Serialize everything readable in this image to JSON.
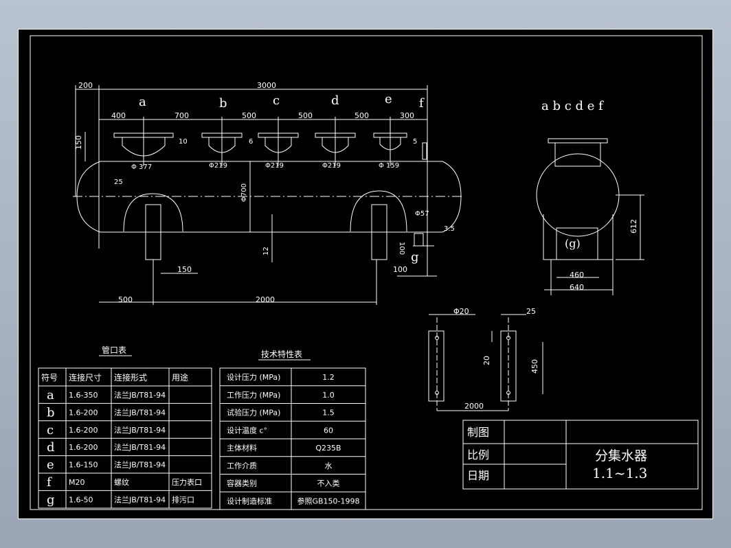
{
  "dims": {
    "d200": "200",
    "d3000": "3000",
    "d400": "400",
    "d700": "700",
    "d500a": "500",
    "d500b": "500",
    "d500c": "500",
    "d300": "300",
    "d150": "150",
    "d10": "10",
    "d6": "6",
    "d5": "5",
    "d25": "25",
    "phi377": "Φ 377",
    "phi219a": "Φ219",
    "phi219b": "Φ219",
    "phi219c": "Φ219",
    "phi159": "Φ 159",
    "phi700": "Φ700",
    "phi57": "Φ57",
    "d3_5": "3.5",
    "d100v": "100",
    "d12": "12",
    "d150b": "150",
    "d100": "100",
    "d500": "500",
    "d2000": "2000",
    "d612": "612",
    "d460": "460",
    "d640": "640",
    "phi20": "Φ20",
    "d25b": "25",
    "d20": "20",
    "d450": "450",
    "d2000b": "2000"
  },
  "nozzle_letters": [
    "a",
    "b",
    "c",
    "d",
    "e",
    "f",
    "g"
  ],
  "side_view_label": "a b c d e f",
  "side_g": "(g)",
  "nozzle_table": {
    "title": "管口表",
    "headers": [
      "符号",
      "连接尺寸",
      "连接形式",
      "用途"
    ],
    "rows": [
      [
        "a",
        "1.6-350",
        "法兰JB/T81-94",
        ""
      ],
      [
        "b",
        "1.6-200",
        "法兰JB/T81-94",
        ""
      ],
      [
        "c",
        "1.6-200",
        "法兰JB/T81-94",
        ""
      ],
      [
        "d",
        "1.6-200",
        "法兰JB/T81-94",
        ""
      ],
      [
        "e",
        "1.6-150",
        "法兰JB/T81-94",
        ""
      ],
      [
        "f",
        "M20",
        "螺纹",
        "压力表口"
      ],
      [
        "g",
        "1.6-50",
        "法兰JB/T81-94",
        "排污口"
      ]
    ]
  },
  "tech_table": {
    "title": "技术特性表",
    "rows": [
      [
        "设计压力 (MPa)",
        "1.2"
      ],
      [
        "工作压力 (MPa)",
        "1.0"
      ],
      [
        "试验压力 (MPa)",
        "1.5"
      ],
      [
        "设计温度 c°",
        "60"
      ],
      [
        "主体材料",
        "Q235B"
      ],
      [
        "工作介质",
        "水"
      ],
      [
        "容器类别",
        "不入类"
      ],
      [
        "设计制造标准",
        "参照GB150-1998"
      ]
    ]
  },
  "title_block": {
    "label_draw": "制图",
    "label_scale": "比例",
    "label_date": "日期",
    "name": "分集水器",
    "scale_value": "1.1~1.3"
  }
}
